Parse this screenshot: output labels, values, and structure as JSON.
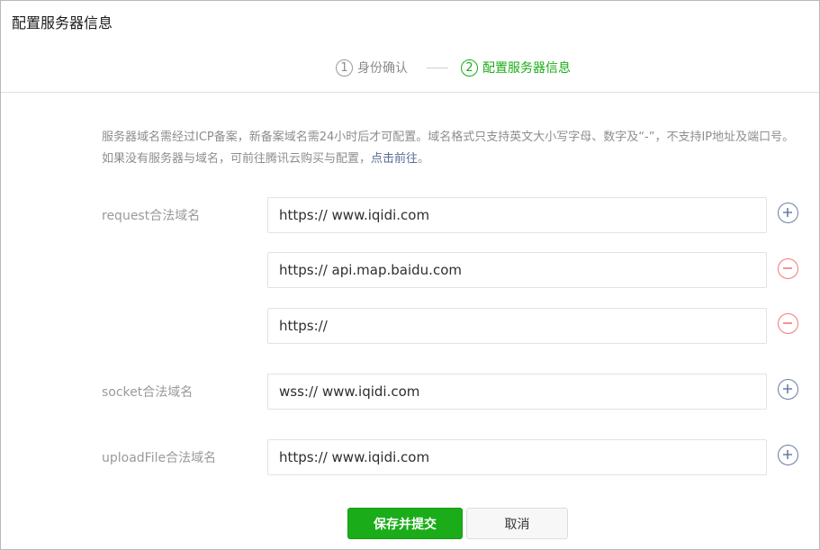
{
  "dialog": {
    "title": "配置服务器信息"
  },
  "steps": [
    {
      "num": "1",
      "label": "身份确认",
      "state": "done"
    },
    {
      "num": "2",
      "label": "配置服务器信息",
      "state": "active"
    }
  ],
  "notice": {
    "text1": "服务器域名需经过ICP备案，新备案域名需24小时后才可配置。域名格式只支持英文大小写字母、数字及“-”，不支持IP地址及端口号。 如果没有服务器与域名，可前往腾讯云购买与配置，",
    "link": "点击前往",
    "text2": "。"
  },
  "fields": {
    "request": {
      "label": "request合法域名",
      "values": [
        "https:// www.iqidi.com",
        "https:// api.map.baidu.com",
        "https://"
      ]
    },
    "socket": {
      "label": "socket合法域名",
      "value": "wss:// www.iqidi.com"
    },
    "upload": {
      "label": "uploadFile合法域名",
      "value": "https:// www.iqidi.com"
    }
  },
  "buttons": {
    "submit": "保存并提交",
    "cancel": "取消"
  },
  "colors": {
    "accent": "#1aad19",
    "link": "#576b95",
    "add": "#6b7da6",
    "remove": "#f37878"
  },
  "icons": {
    "add": "plus-circle-icon",
    "remove": "minus-circle-icon"
  }
}
